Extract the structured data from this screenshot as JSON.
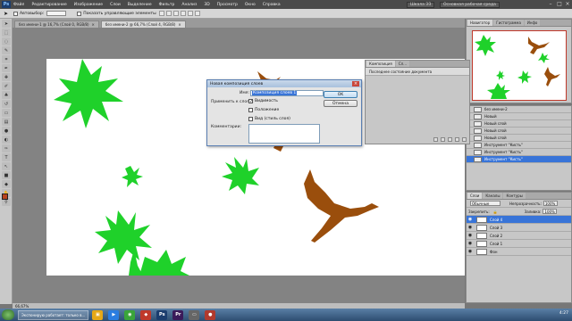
{
  "menubar": {
    "logo": "Ps",
    "items": [
      "Файл",
      "Редактирование",
      "Изображение",
      "Слои",
      "Выделение",
      "Фильтр",
      "Анализ",
      "3D",
      "Просмотр",
      "Окно",
      "Справка"
    ],
    "workspace_button": "Основная рабочая среда",
    "extra_button": "Шкала ЭЗ"
  },
  "optbar": {
    "autoselect_label": "Автовыбор:",
    "show_controls_label": "Показать управляющие элементы"
  },
  "doctabs": [
    {
      "label": "без имени-1 @ 16,7% (Слой 0, RGB/8)",
      "active": false
    },
    {
      "label": "без имени-2 @ 66,7% (Слой 4, RGB/8)",
      "active": true
    }
  ],
  "statusbar": {
    "zoom": "66,67%"
  },
  "navigator": {
    "tabs": [
      "Навигатор",
      "Гистограмма",
      "Инфо"
    ]
  },
  "history": {
    "rows": [
      {
        "label": "без имени-2",
        "selected": false
      },
      {
        "label": "Новый",
        "selected": false
      },
      {
        "label": "Новый слой",
        "selected": false
      },
      {
        "label": "Новый слой",
        "selected": false
      },
      {
        "label": "Новый слой",
        "selected": false
      },
      {
        "label": "Инструмент \"Кисть\"",
        "selected": false
      },
      {
        "label": "Инструмент \"Кисть\"",
        "selected": false
      },
      {
        "label": "Инструмент \"Кисть\"",
        "selected": true
      }
    ]
  },
  "layers": {
    "tabs": [
      "Слои",
      "Каналы",
      "Контуры"
    ],
    "blend_mode": "Обычные",
    "opacity_label": "Непрозрачность:",
    "opacity_value": "100%",
    "lock_label": "Закрепить:",
    "fill_label": "Заливка:",
    "fill_value": "100%",
    "rows": [
      {
        "label": "Слой 4",
        "selected": true
      },
      {
        "label": "Слой 3",
        "selected": false
      },
      {
        "label": "Слой 2",
        "selected": false
      },
      {
        "label": "Слой 1",
        "selected": false
      },
      {
        "label": "Фон",
        "selected": false
      }
    ]
  },
  "comps": {
    "tabs": [
      "Композиция",
      "Сл..."
    ],
    "row": "Последнее состояние документа"
  },
  "dialog": {
    "title": "Новая композиция слоев",
    "name_label": "Имя:",
    "name_value": "Композиция слоев 1",
    "apply_label": "Применить к слоям:",
    "visibility_label": "Видимость",
    "position_label": "Положение",
    "style_label": "Вид (стиль слоя)",
    "comment_label": "Комментарии:",
    "ok_label": "OK",
    "cancel_label": "Отмена"
  },
  "taskbar": {
    "task_label": "Экспонирую работает: только в...",
    "clock": "4:27"
  },
  "colors": {
    "leaf_green": "#1fd12a",
    "bird_brown": "#9a4e0c",
    "selection_blue": "#3874d8"
  }
}
